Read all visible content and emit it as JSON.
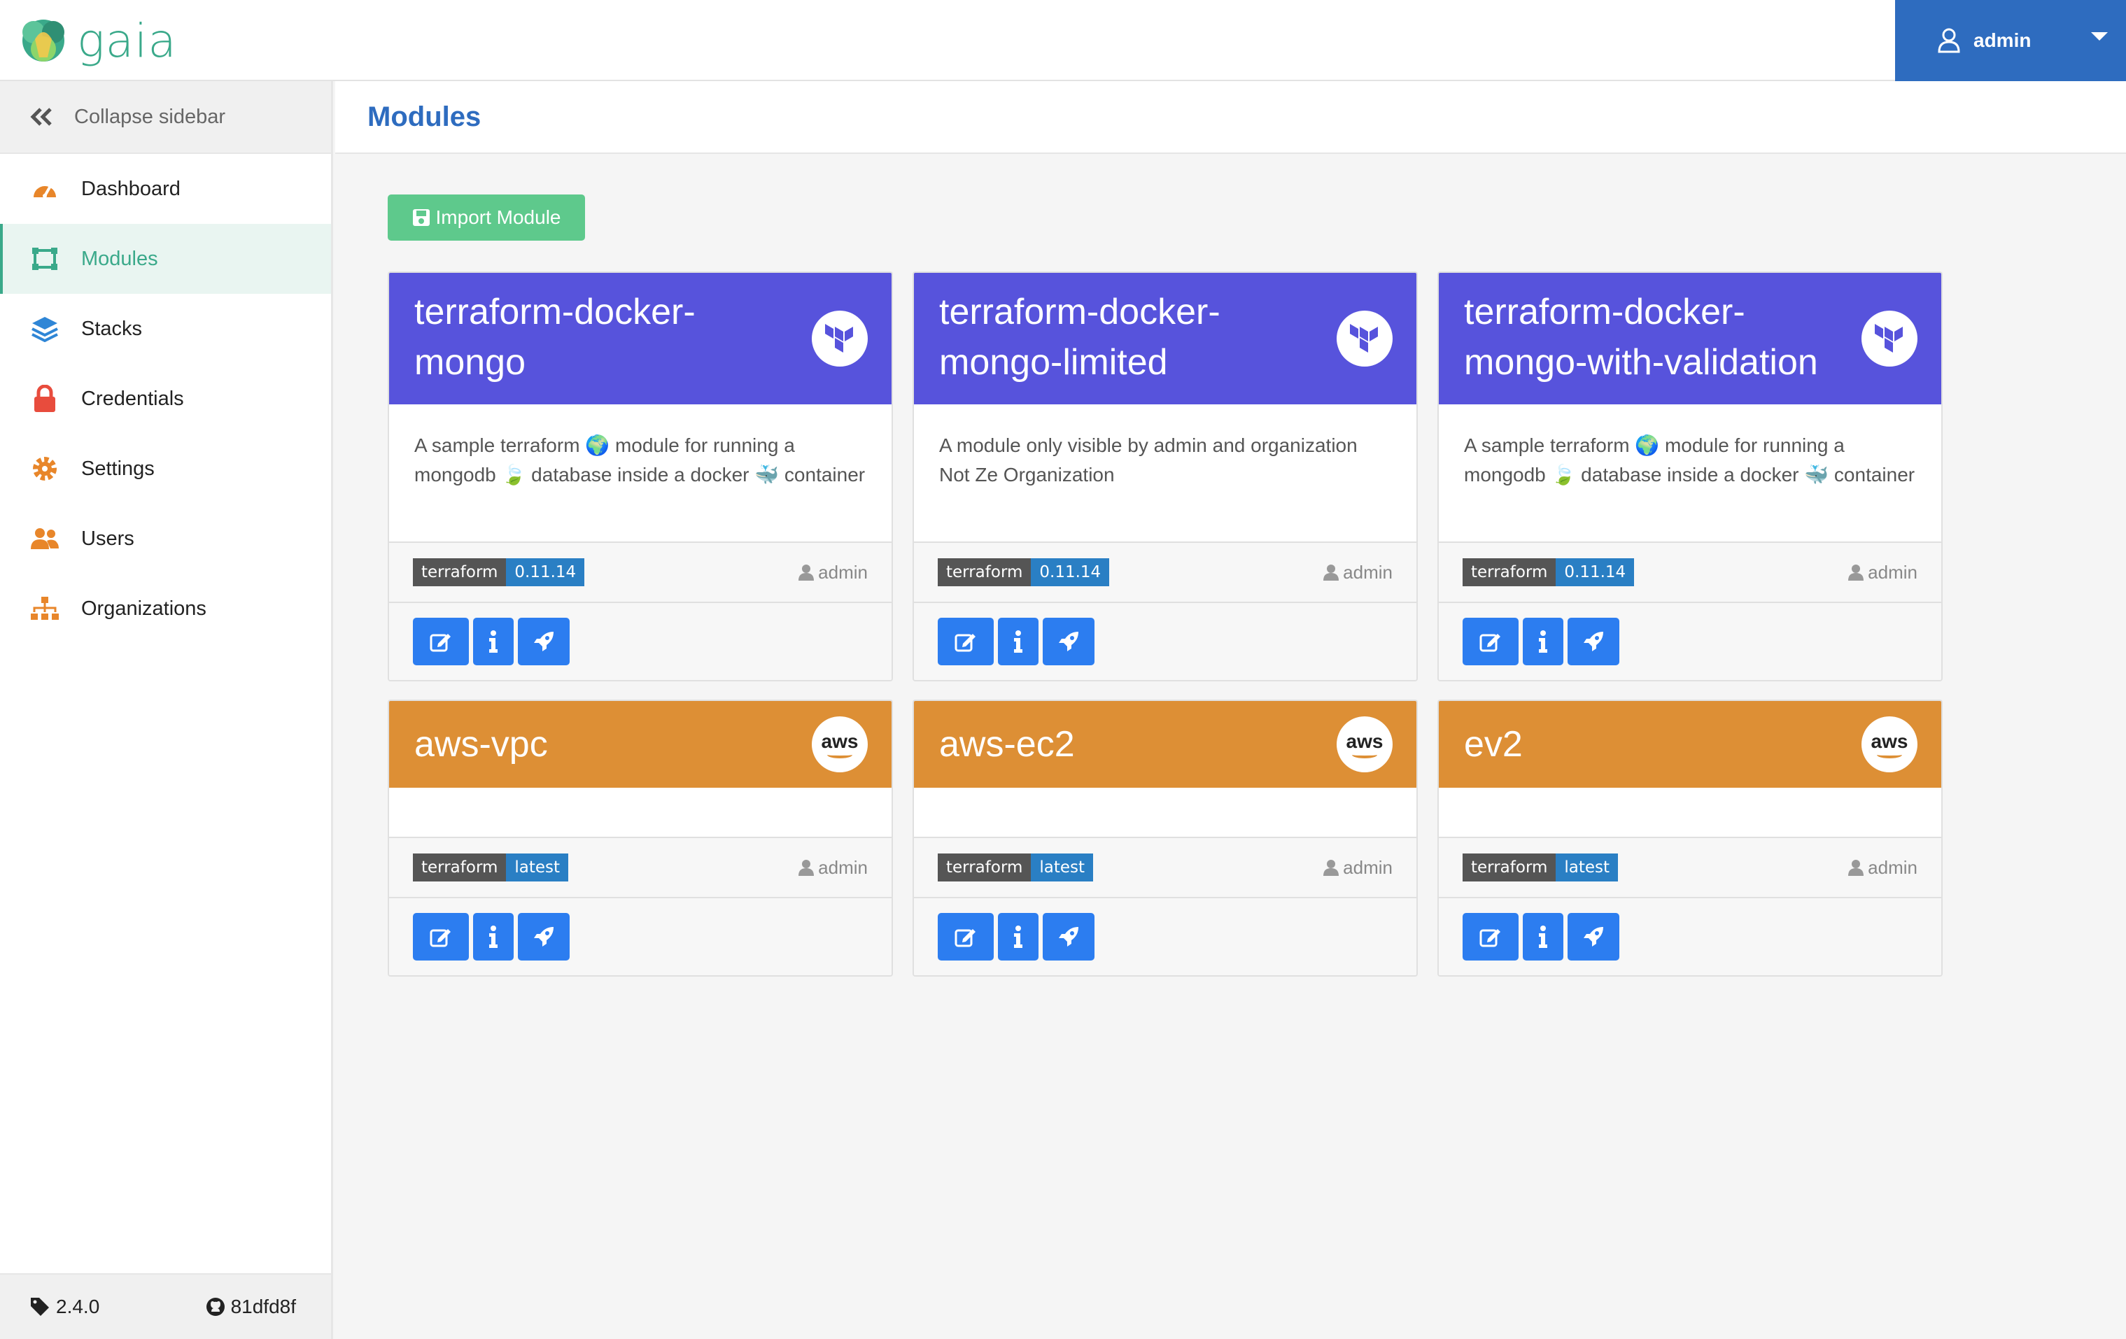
{
  "brand": {
    "name": "gaia"
  },
  "user": {
    "name": "admin"
  },
  "sidebar": {
    "collapse_label": "Collapse sidebar",
    "items": [
      {
        "label": "Dashboard",
        "icon": "dashboard-icon"
      },
      {
        "label": "Modules",
        "icon": "modules-icon",
        "active": true
      },
      {
        "label": "Stacks",
        "icon": "stacks-icon"
      },
      {
        "label": "Credentials",
        "icon": "lock-icon"
      },
      {
        "label": "Settings",
        "icon": "gear-icon"
      },
      {
        "label": "Users",
        "icon": "users-icon"
      },
      {
        "label": "Organizations",
        "icon": "sitemap-icon"
      }
    ],
    "footer": {
      "version": "2.4.0",
      "commit": "81dfd8f"
    }
  },
  "page": {
    "title": "Modules",
    "import_label": "Import Module"
  },
  "colors": {
    "terraform": "#5753dc",
    "aws": "#dd8f35",
    "accent": "#3aa98a",
    "primary": "#2e6cbf",
    "action": "#2c7df0"
  },
  "modules": [
    {
      "name": "terraform-docker-mongo",
      "provider": "terraform",
      "description": "A sample terraform 🌍 module for running a mongodb 🍃 database inside a docker 🐳 container",
      "badge_left": "terraform",
      "badge_right": "0.11.14",
      "owner": "admin"
    },
    {
      "name": "terraform-docker-mongo-limited",
      "provider": "terraform",
      "description": "A module only visible by admin and organization Not Ze Organization",
      "badge_left": "terraform",
      "badge_right": "0.11.14",
      "owner": "admin"
    },
    {
      "name": "terraform-docker-mongo-with-validation",
      "provider": "terraform",
      "description": "A sample terraform 🌍 module for running a mongodb 🍃 database inside a docker 🐳 container",
      "badge_left": "terraform",
      "badge_right": "0.11.14",
      "owner": "admin"
    },
    {
      "name": "aws-vpc",
      "provider": "aws",
      "description": "",
      "badge_left": "terraform",
      "badge_right": "latest",
      "owner": "admin"
    },
    {
      "name": "aws-ec2",
      "provider": "aws",
      "description": "",
      "badge_left": "terraform",
      "badge_right": "latest",
      "owner": "admin"
    },
    {
      "name": "ev2",
      "provider": "aws",
      "description": "",
      "badge_left": "terraform",
      "badge_right": "latest",
      "owner": "admin"
    }
  ],
  "provider_logo_text": {
    "aws": "aws"
  }
}
